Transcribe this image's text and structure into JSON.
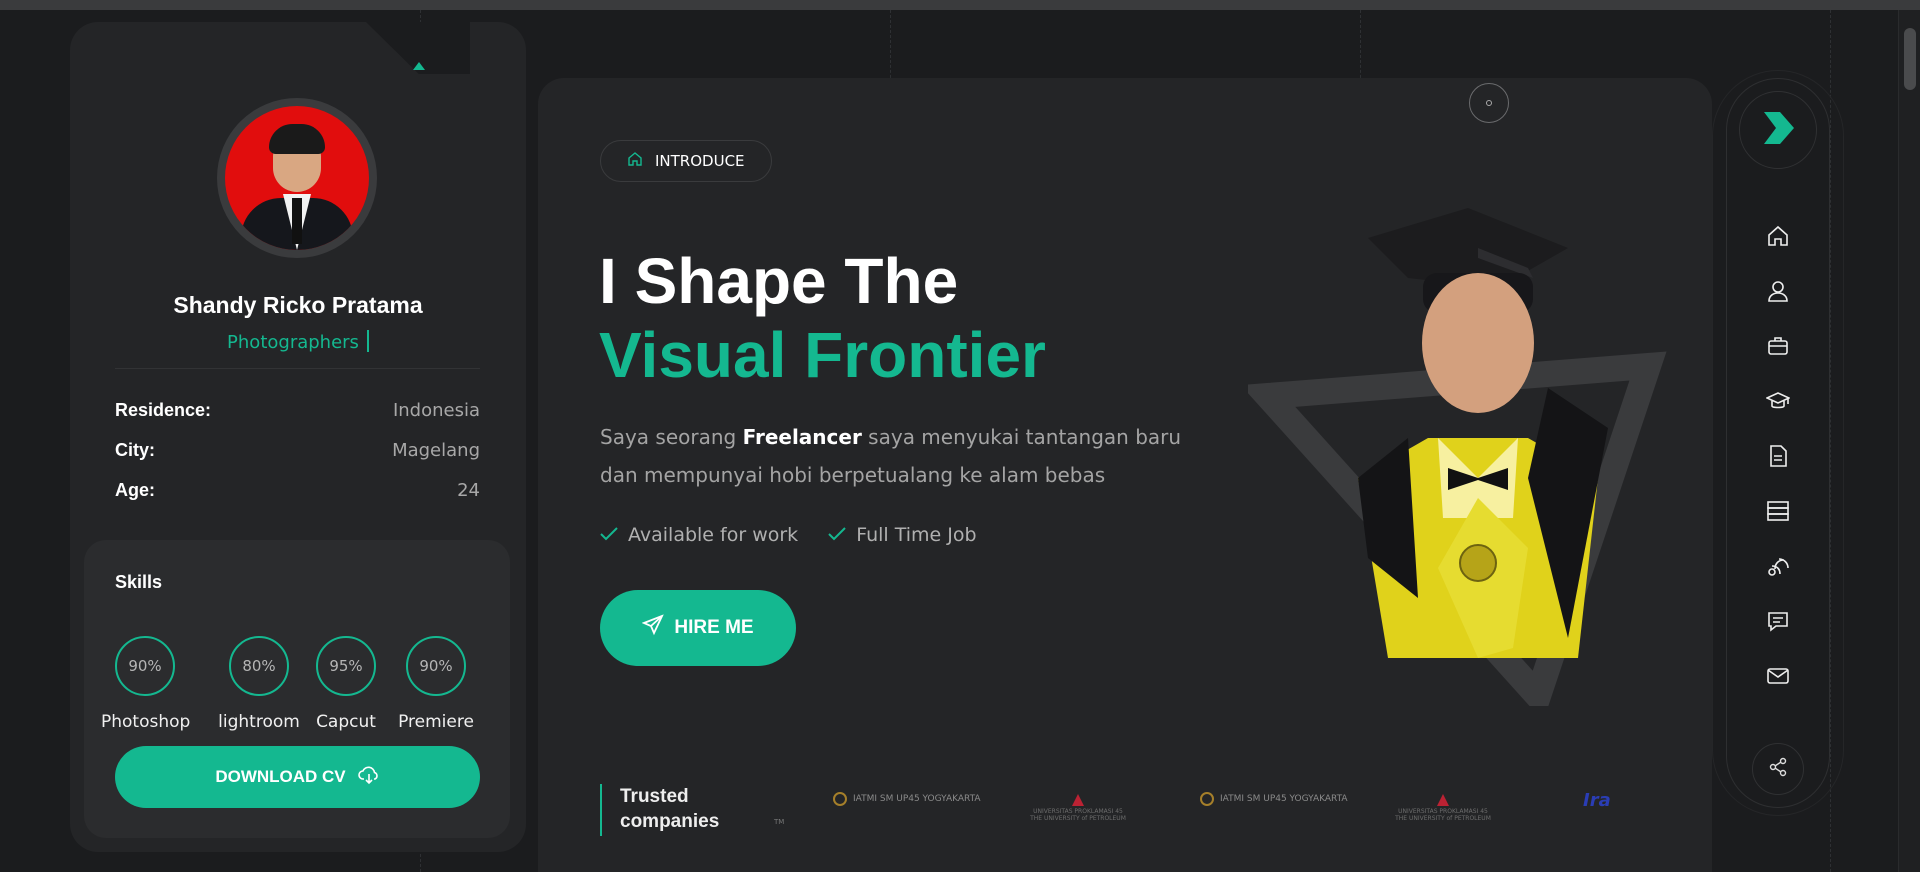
{
  "profile": {
    "name": "Shandy Ricko Pratama",
    "role": "Photographers",
    "info": [
      {
        "key": "Residence:",
        "value": "Indonesia"
      },
      {
        "key": "City:",
        "value": "Magelang"
      },
      {
        "key": "Age:",
        "value": "24"
      }
    ],
    "skills_title": "Skills",
    "skills": [
      {
        "pct": "90%",
        "name": "Photoshop"
      },
      {
        "pct": "80%",
        "name": "lightroom"
      },
      {
        "pct": "95%",
        "name": "Capcut"
      },
      {
        "pct": "90%",
        "name": "Premiere"
      }
    ],
    "download_label": "DOWNLOAD CV"
  },
  "hero": {
    "chip_label": "INTRODUCE",
    "headline_1": "I Shape The",
    "headline_2": "Visual Frontier",
    "desc_pre": "Saya seorang ",
    "desc_bold": "Freelancer",
    "desc_post": " saya menyukai tantangan baru dan mempunyai hobi berpetualang ke alam bebas",
    "badge_1": "Available for work",
    "badge_2": "Full Time Job",
    "hire_label": "HIRE ME",
    "trusted_1": "Trusted",
    "trusted_2": "companies",
    "tm": "TM",
    "logo_a": "IATMI SM UP45 YOGYAKARTA",
    "logo_b_1": "UNIVERSITAS PROKLAMASI 45",
    "logo_b_2": "THE UNIVERSITY of PETROLEUM",
    "logo_c": "Ira"
  },
  "colors": {
    "accent": "#14b890",
    "bg": "#1b1c1e",
    "card": "#242527"
  },
  "nav_icons": [
    "home-icon",
    "user-icon",
    "briefcase-icon",
    "graduation-cap-icon",
    "document-icon",
    "server-icon",
    "blog-icon",
    "chat-icon",
    "mail-icon",
    "share-icon"
  ]
}
